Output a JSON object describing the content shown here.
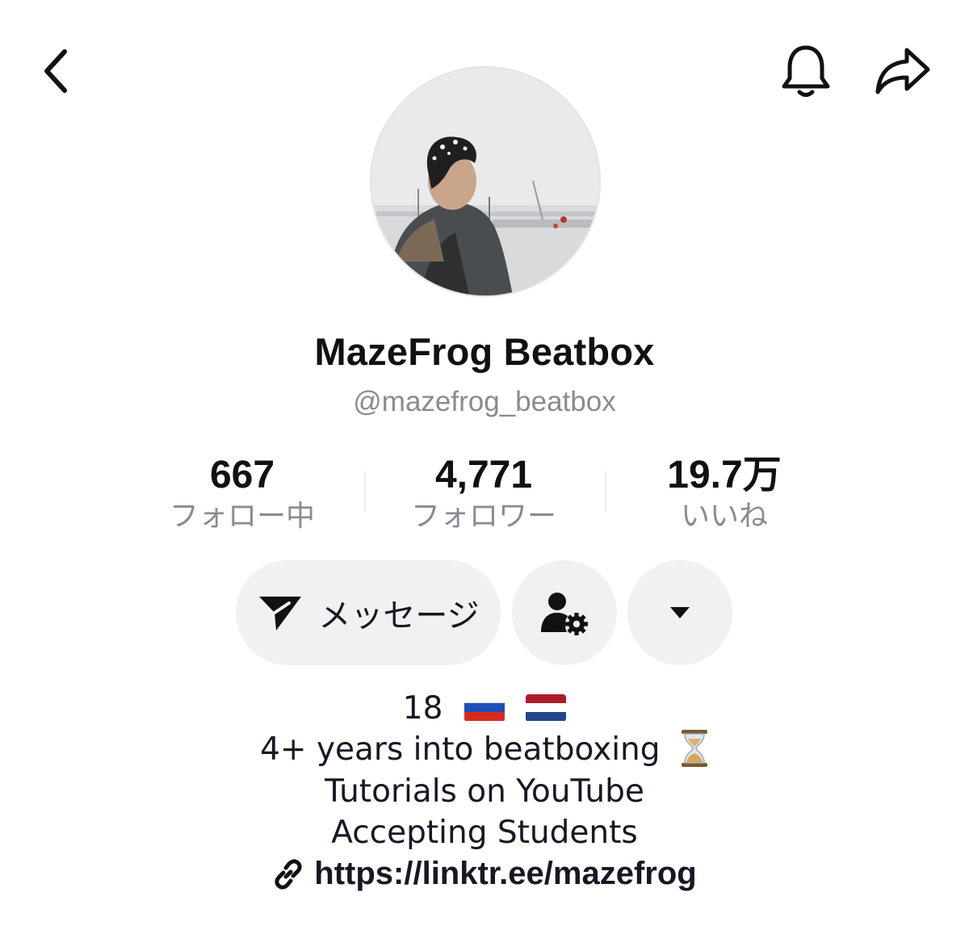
{
  "profile": {
    "display_name": "MazeFrog Beatbox",
    "handle": "@mazefrog_beatbox"
  },
  "stats": {
    "following": {
      "value": "667",
      "label": "フォロー中"
    },
    "followers": {
      "value": "4,771",
      "label": "フォロワー"
    },
    "likes": {
      "value": "19.7万",
      "label": "いいね"
    }
  },
  "actions": {
    "message_label": "メッセージ"
  },
  "bio": {
    "age": "18",
    "flags": [
      "russia-flag",
      "netherlands-flag"
    ],
    "lines": [
      "4+ years into beatboxing",
      "Tutorials on YouTube",
      "Accepting Students"
    ],
    "line1_emoji": "hourglass-icon",
    "link": "https://linktr.ee/mazefrog"
  },
  "icons": {
    "back": "chevron-left-icon",
    "notification": "bell-icon",
    "share": "share-arrow-icon",
    "message": "send-icon",
    "friend_settings": "user-gear-icon",
    "more": "caret-down-icon",
    "link": "link-icon"
  },
  "colors": {
    "text": "#161823",
    "muted": "#8a8b91",
    "button_bg": "#f1f1f2"
  }
}
